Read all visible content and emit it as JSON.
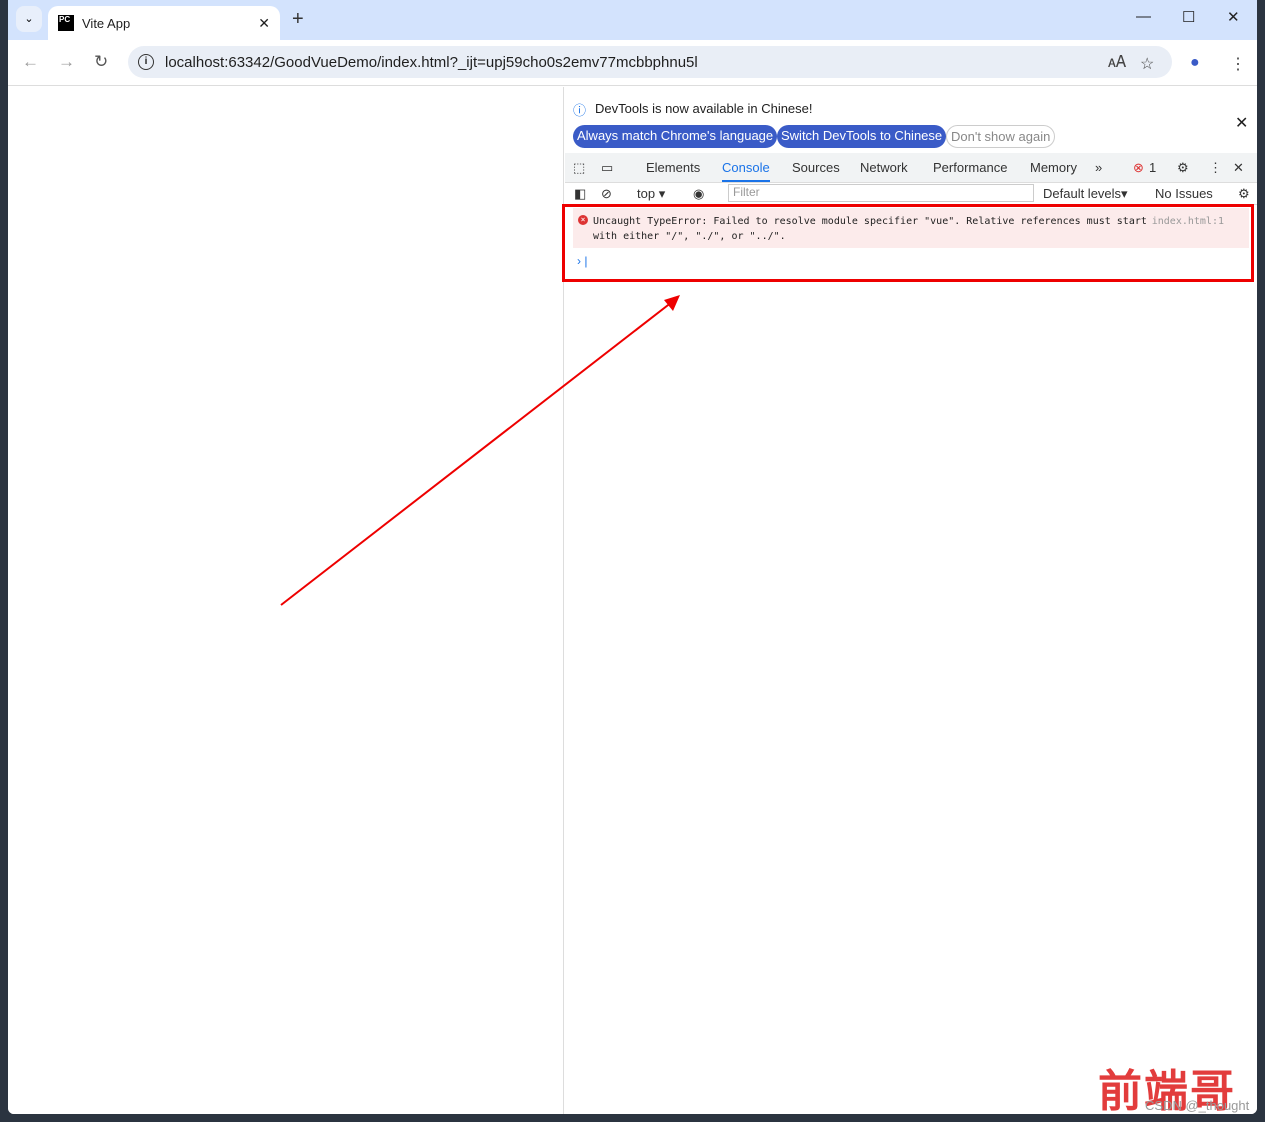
{
  "browser": {
    "tab_title": "Vite App",
    "favicon": "PC",
    "url": "localhost:63342/GoodVueDemo/index.html?_ijt=upj59cho0s2emv77mcbbphnu5l"
  },
  "devtools": {
    "info_message": "DevTools is now available in Chinese!",
    "buttons": {
      "match": "Always match Chrome's language",
      "switch": "Switch DevTools to Chinese",
      "dont_show": "Don't show again"
    },
    "tabs": [
      "Elements",
      "Console",
      "Sources",
      "Network",
      "Performance",
      "Memory"
    ],
    "active_tab": "Console",
    "error_count": "1",
    "console_toolbar": {
      "context": "top",
      "filter_placeholder": "Filter",
      "levels": "Default levels",
      "issues": "No Issues"
    },
    "error": {
      "line1": "Uncaught TypeError: Failed to resolve module specifier \"vue\". Relative references must start",
      "line2": "with either \"/\", \"./\", or \"../\".",
      "source": "index.html:1"
    }
  },
  "watermark": {
    "text": "前端哥",
    "credit": "CSDN @_thought"
  },
  "colors": {
    "annotation": "#ee0000",
    "accent": "#3a5bc7"
  }
}
